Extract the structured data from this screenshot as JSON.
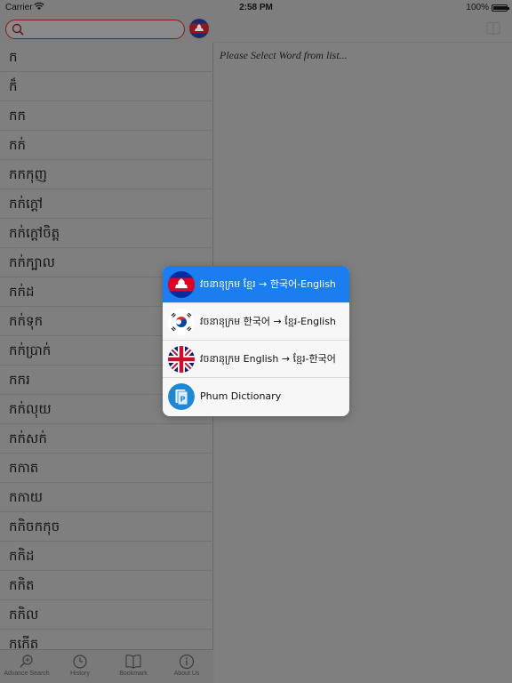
{
  "status_bar": {
    "carrier": "Carrier",
    "time": "2:58 PM",
    "battery": "100%",
    "battery_level": 1.0
  },
  "search": {
    "placeholder": "",
    "value": ""
  },
  "word_list": [
    "ក",
    "ក៏",
    "កក",
    "កក់",
    "កកកុញ",
    "កក់ក្ដៅ",
    "កក់ក្ដៅចិត្ត",
    "កក់ក្បាល",
    "កក់ដ",
    "កក់ទុក",
    "កក់ប្រាក់",
    "កករ",
    "កក់លុយ",
    "កក់សក់",
    "កកាត",
    "កកាយ",
    "កកិចកកុច",
    "កកិដ",
    "កកិត",
    "កកិល",
    "កកើត"
  ],
  "tabs": [
    {
      "label": "Advance Search",
      "icon": "search-plus-icon"
    },
    {
      "label": "History",
      "icon": "clock-icon"
    },
    {
      "label": "Bookmark",
      "icon": "book-icon"
    },
    {
      "label": "About Us",
      "icon": "info-icon"
    }
  ],
  "detail": {
    "placeholder": "Please Select Word from list..."
  },
  "menu": {
    "items": [
      {
        "label": "វចនានុក្រម ខ្មែរ → 한국어-English",
        "icon": "cambodia-flag-icon",
        "selected": true
      },
      {
        "label": "វចនានុក្រម 한국어 → ខ្មែរ-English",
        "icon": "korea-flag-icon",
        "selected": false
      },
      {
        "label": "វចនានុក្រម English → ខ្មែរ-한국어",
        "icon": "uk-flag-icon",
        "selected": false
      },
      {
        "label": "Phum Dictionary",
        "icon": "phum-dictionary-icon",
        "selected": false
      }
    ]
  },
  "colors": {
    "accent": "#1a7ef0",
    "search_border": "#8b1a1a",
    "dim_overlay": "#7f7f7f"
  }
}
